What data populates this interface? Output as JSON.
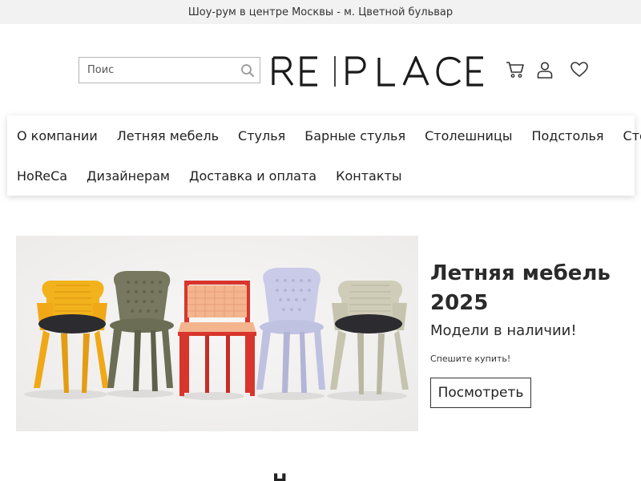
{
  "topbar": {
    "text": "Шоу-рум в центре Москвы - м. Цветной бульвар"
  },
  "header": {
    "search_placeholder": "Поис",
    "logo_text": "RE|PLACE",
    "icons": [
      "search-icon",
      "cart-icon",
      "user-icon",
      "heart-icon"
    ]
  },
  "nav": {
    "row1": [
      "О компании",
      "Летняя мебель",
      "Стулья",
      "Барные стулья",
      "Столешницы",
      "Подстолья",
      "Столы"
    ],
    "row2": [
      "HoReCa",
      "Дизайнерам",
      "Доставка и оплата",
      "Контакты"
    ]
  },
  "promo": {
    "title": "Летняя мебель 2025",
    "subtitle": "Модели в наличии!",
    "small": "Спешите купить!",
    "button": "Посмотреть"
  },
  "section": {
    "heading_fragment": "Н"
  },
  "colors": {
    "topbar_bg": "#f2f2f2",
    "chair_yellow": "#f2b21c",
    "chair_olive": "#77785f",
    "chair_red": "#d8352c",
    "chair_lavender": "#c9cbe8",
    "chair_beige": "#cfcdb8"
  }
}
